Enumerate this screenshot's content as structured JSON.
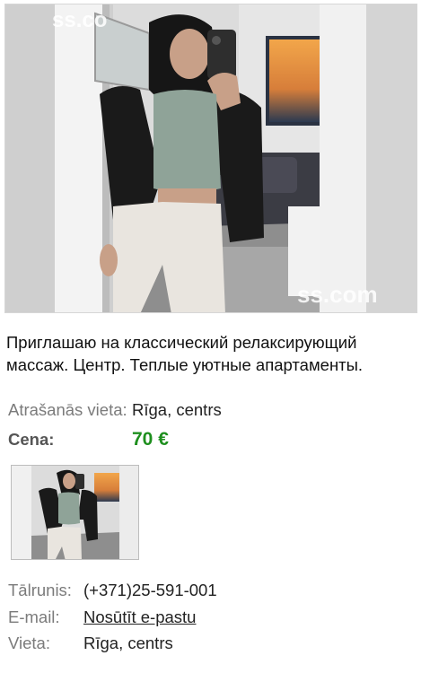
{
  "listing": {
    "watermark_top": "ss.co",
    "watermark_bottom": "ss.com",
    "description": "Приглашаю на классический релаксирующий массаж. Центр. Теплые уютные апартаменты.",
    "location_label": "Atrašanās vieta:",
    "location_value": "Rīga, centrs",
    "price_label": "Cena:",
    "price_value": "70 €",
    "price_color": "#1e8f1e"
  },
  "contacts": {
    "phone_label": "Tālrunis:",
    "phone_prefix": "(+371)",
    "phone_number": "25-591-001",
    "email_label": "E-mail:",
    "email_link": "Nosūtīt e-pastu",
    "place_label": "Vieta:",
    "place_value": "Rīga, centrs"
  },
  "colors": {
    "link": "#1a5fb4",
    "label_gray": "#7b7b7b"
  }
}
